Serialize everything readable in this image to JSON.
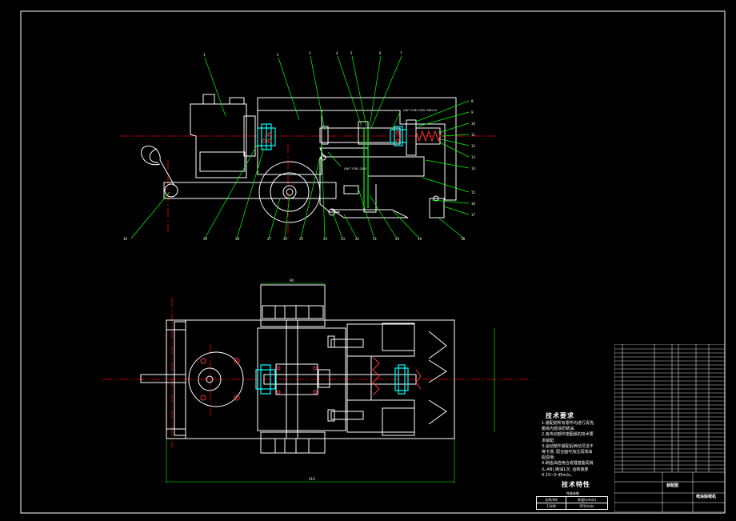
{
  "callouts": {
    "top_row": [
      "1",
      "2",
      "3",
      "4",
      "5",
      "6",
      "7"
    ],
    "right_column": [
      "8",
      "9",
      "10",
      "11",
      "12",
      "13",
      "14",
      "15",
      "16",
      "17"
    ],
    "bottom_row": [
      "30",
      "29",
      "28",
      "27",
      "26",
      "25",
      "24",
      "23",
      "22",
      "21",
      "20",
      "19",
      "18"
    ],
    "spec_labels": [
      "GB/T 5783-2000 M8×25",
      "GB/T 5783-2000"
    ]
  },
  "plan_view": {
    "dimension_top": "90",
    "dimension_bottom": "410"
  },
  "tech_requirements": {
    "title": "技术要求",
    "lines": [
      "1.装配前所有零件均进行清洗,",
      "箱体内部涂防锈油;",
      "2.各传动部件按图纸的技术要",
      "求装配;",
      "3.运动部件装配后转动灵活不",
      "得卡滞, 配合面可加注润滑油",
      "脂润滑;",
      "4.刷齿油选用合成锂基脂润滑",
      "(L-AN),换油1次, 运转速度",
      "0.15~0.45m/s。"
    ]
  },
  "tech_specs": {
    "title": "技术特性",
    "caption": "性能参数",
    "header": [
      "功率/kW",
      "转速/(r/min)"
    ],
    "values": [
      "11kW",
      "970r/min"
    ]
  },
  "title_block": {
    "drawing_name": "装配图",
    "product_name": "喷涂除锈机"
  }
}
